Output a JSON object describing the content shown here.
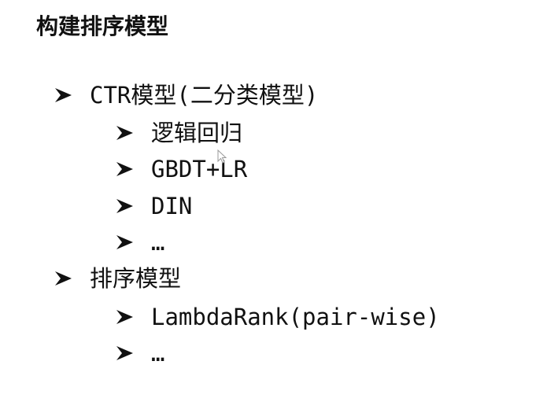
{
  "slide": {
    "title": "构建排序模型",
    "items": [
      {
        "label": "CTR模型(二分类模型)",
        "children": [
          {
            "label": "逻辑回归"
          },
          {
            "label": "GBDT+LR"
          },
          {
            "label": "DIN"
          },
          {
            "label": "…"
          }
        ]
      },
      {
        "label": "排序模型",
        "children": [
          {
            "label": "LambdaRank(pair-wise)"
          },
          {
            "label": "…"
          }
        ]
      }
    ]
  },
  "icons": {
    "bullet": "arrowhead-bullet-icon",
    "cursor": "mouse-pointer-icon"
  },
  "colors": {
    "background": "#ffffff",
    "text": "#111111"
  }
}
